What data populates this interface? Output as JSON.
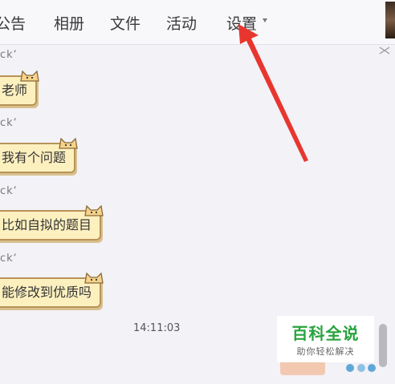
{
  "tabs": [
    {
      "label": "公告"
    },
    {
      "label": "相册"
    },
    {
      "label": "文件"
    },
    {
      "label": "活动"
    },
    {
      "label": "设置"
    }
  ],
  "messages": [
    {
      "sender": "ck‘",
      "text": "老师"
    },
    {
      "sender": "ck‘",
      "text": "我有个问题"
    },
    {
      "sender": "ck‘",
      "text": "比如自拟的题目"
    },
    {
      "sender": "ck‘",
      "text": "能修改到优质吗"
    }
  ],
  "timestamp": "14:11:03",
  "watermark": {
    "title": "百科全说",
    "subtitle": "助你轻松解决"
  },
  "colors": {
    "arrow": "#e8362e",
    "bubble_fill": "#fdf0bf",
    "watermark_green": "#27a33d"
  },
  "icons": [
    "chevron-down-icon",
    "close-icon",
    "cat-sticker-icon",
    "arrow-annotation"
  ]
}
